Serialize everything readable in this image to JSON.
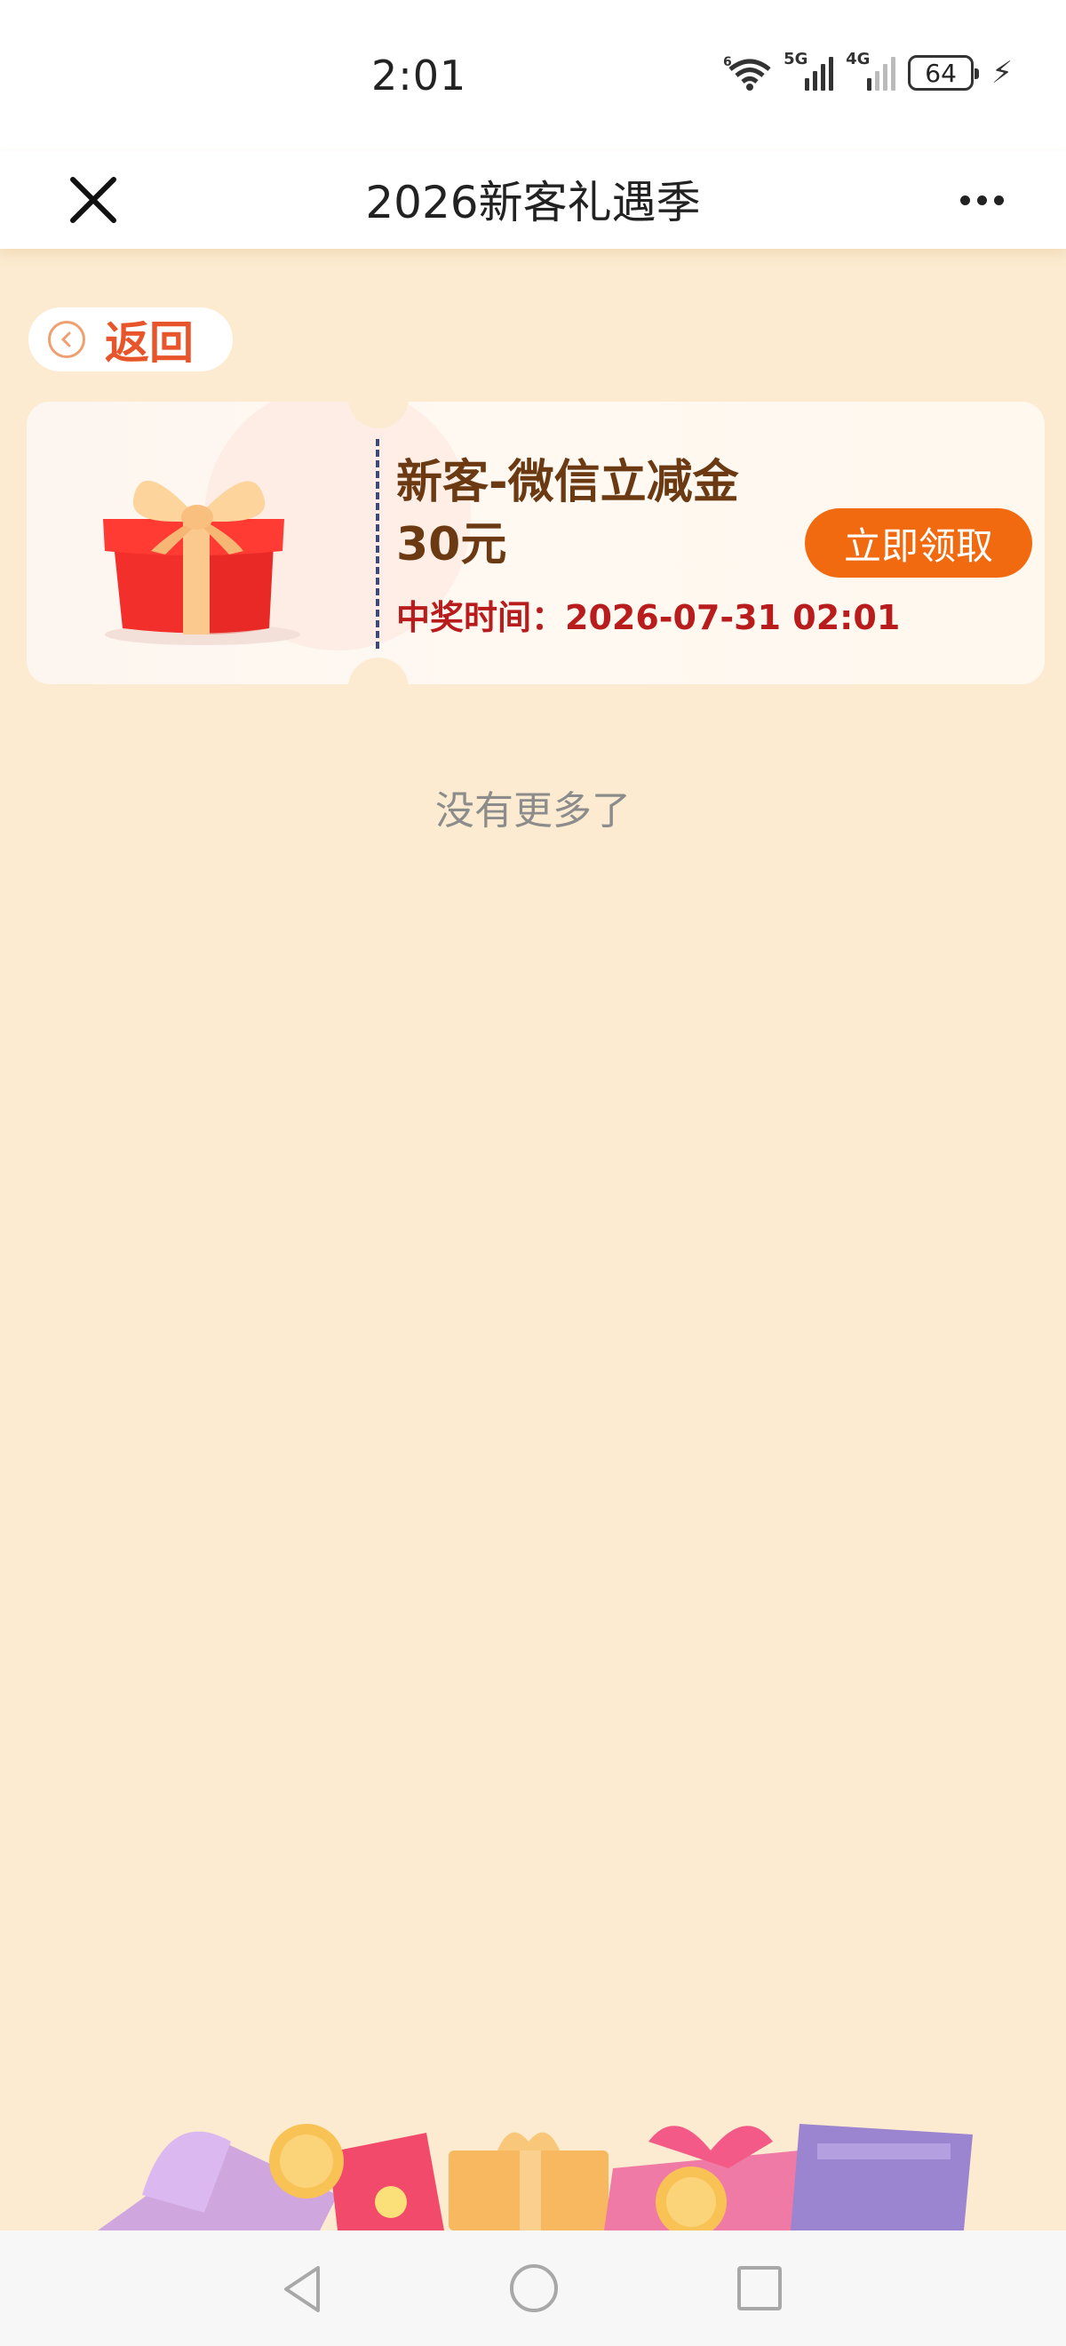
{
  "status_bar": {
    "time": "2:01",
    "wifi_badge": "6",
    "signal_1_label": "5G",
    "signal_2_label": "4G",
    "battery": "64",
    "charging_icon": "bolt-icon"
  },
  "title_bar": {
    "title": "2026新客礼遇季",
    "close_icon": "close-icon",
    "more_icon": "more-icon"
  },
  "back_button": {
    "label": "返回",
    "icon": "chevron-left-circle-icon"
  },
  "coupon": {
    "name": "新客-微信立减金",
    "amount": "30元",
    "win_time": "中奖时间：2026-07-31 02:01",
    "claim_label": "立即领取",
    "image": "gift-box-icon"
  },
  "list_end": "没有更多了",
  "colors": {
    "background": "#fcebd0",
    "accent": "#f26a10",
    "coupon_title": "#6b3a12",
    "win_time": "#b81c1c",
    "back_label": "#e8552a"
  },
  "nav_bar": {
    "back_icon": "triangle-back-icon",
    "home_icon": "circle-home-icon",
    "recent_icon": "square-recent-icon"
  }
}
